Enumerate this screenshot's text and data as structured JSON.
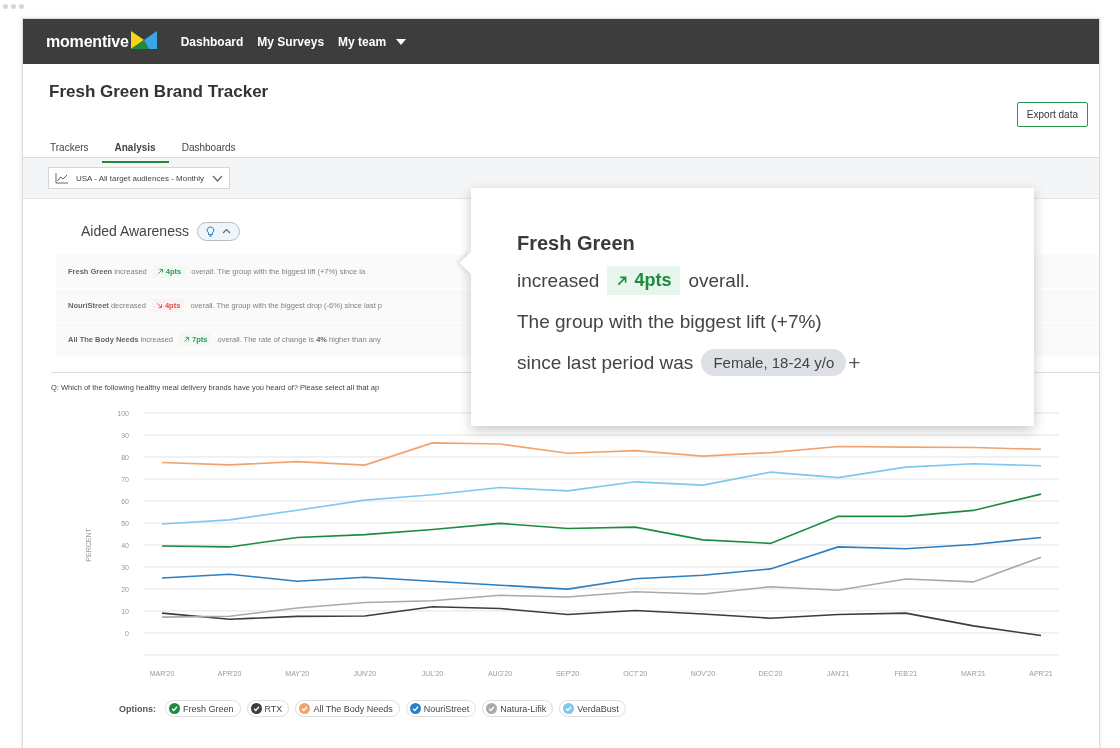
{
  "nav": {
    "logo": "momentive",
    "items": [
      {
        "label": "Dashboard",
        "kind": "link"
      },
      {
        "label": "My Surveys",
        "kind": "link"
      },
      {
        "label": "My team",
        "kind": "menu"
      }
    ]
  },
  "page": {
    "title": "Fresh Green Brand Tracker",
    "export_button": "Export data"
  },
  "tabs": [
    {
      "label": "Trackers",
      "selected": false
    },
    {
      "label": "Analysis",
      "selected": true
    },
    {
      "label": "Dashboards",
      "selected": false
    }
  ],
  "filter": {
    "label": "USA - All target audiences - Monthly"
  },
  "insights": {
    "title": "Aided Awareness",
    "rows": [
      {
        "lead": "**Fresh Green** increased",
        "change": "4pts",
        "rising": true,
        "text": "overall. The group with the biggest lift (+7%) since la"
      },
      {
        "lead": "**NouriStreet** decreased",
        "change": "4pts",
        "rising": false,
        "text": "overall. The group with the biggest drop (-6%) since last p"
      },
      {
        "lead": "**All The Body Needs** increased",
        "change": "7pts",
        "rising": true,
        "text": "overall. The rate of change is **4%** higher than any"
      }
    ]
  },
  "popup": {
    "title": "Fresh Green",
    "verb": "increased",
    "change": "4pts",
    "rising": true,
    "suffix": "overall.",
    "line2": "The group with the biggest lift (+7%)",
    "line3": "since last period was",
    "segment": "Female, 18-24 y/o",
    "add": "+"
  },
  "question": "Q: Which of the following healthy meal delivery brands have you heard of? Please select all that ap",
  "chart_data": {
    "type": "line",
    "ylabel": "PERCENT",
    "categories": [
      "MAR'20",
      "APR'20",
      "MAY'20",
      "JUN'20",
      "JUL'20",
      "AUG'20",
      "SEP'20",
      "OCT'20",
      "NOV'20",
      "DEC'20",
      "JAN'21",
      "FEB'21",
      "MAR'21",
      "APR'21"
    ],
    "ylim": [
      -10,
      100
    ],
    "grid": true,
    "yticks": [
      0,
      10,
      20,
      30,
      40,
      50,
      60,
      70,
      80,
      90,
      100
    ],
    "series": [
      {
        "name": "Fresh Green",
        "color": "#1e8a3e",
        "values": [
          39.5,
          39.1,
          43.4,
          44.7,
          47,
          49.8,
          47.5,
          48.1,
          42.3,
          40.7,
          53,
          53,
          55.7,
          63.1
        ]
      },
      {
        "name": "RTX",
        "color": "#3d3d3d",
        "values": [
          9,
          6.2,
          7.5,
          7.7,
          11.9,
          11.1,
          8.4,
          10.2,
          8.6,
          6.7,
          8.4,
          9,
          3.2,
          -1.2
        ]
      },
      {
        "name": "All The Body Needs",
        "color": "#f2a36b",
        "values": [
          77.5,
          76.4,
          77.9,
          76.3,
          86.4,
          85.9,
          81.7,
          82.9,
          80.4,
          82,
          84.8,
          84.5,
          84.3,
          83.5
        ]
      },
      {
        "name": "NouriStreet",
        "color": "#2d7fc1",
        "values": [
          25,
          26.7,
          23.5,
          25.3,
          23.5,
          21.7,
          19.9,
          24.6,
          26.2,
          29.1,
          39.1,
          38.3,
          40.2,
          43.4
        ]
      },
      {
        "name": "Natura-Lifik",
        "color": "#a9a9a9",
        "values": [
          7.2,
          7.6,
          11.3,
          13.8,
          14.6,
          17.1,
          16.3,
          18.7,
          17.7,
          21,
          19.4,
          24.5,
          23.2,
          34.4
        ]
      },
      {
        "name": "VerdaBust",
        "color": "#7ec8ee",
        "values": [
          49.5,
          51.4,
          55.8,
          60.4,
          62.8,
          66.1,
          64.6,
          68.7,
          67.2,
          73.1,
          70.6,
          75.4,
          76.9,
          76
        ]
      }
    ]
  },
  "legend": {
    "label": "Options:"
  }
}
